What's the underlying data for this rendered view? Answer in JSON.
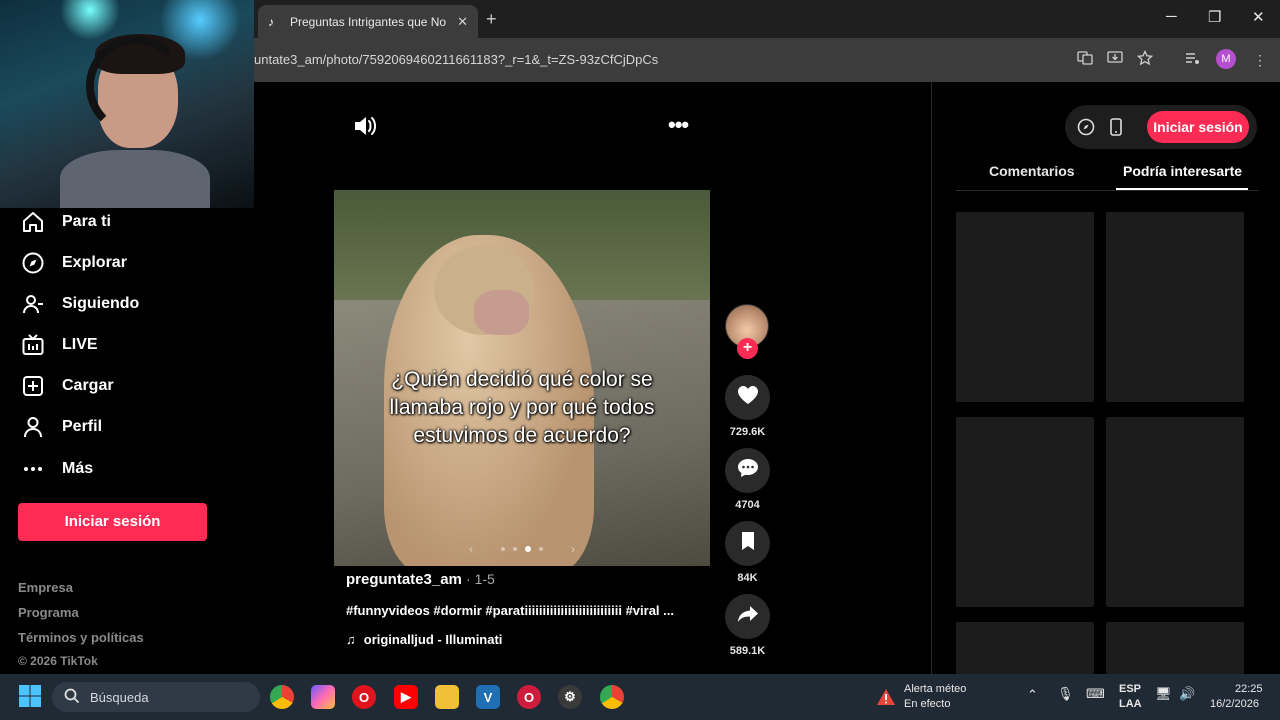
{
  "browser": {
    "tab_title": "Preguntas Intrigantes que No T",
    "tab_close": "✕",
    "new_tab": "+",
    "url": "untate3_am/photo/7592069460211661183?_r=1&_t=ZS-93zCfCjDpCs",
    "profile_initial": "M",
    "window_controls": {
      "minimize": "─",
      "maximize": "❐",
      "close": "✕"
    }
  },
  "sidebar": {
    "items": [
      {
        "label": "Para ti",
        "icon": "home-icon"
      },
      {
        "label": "Explorar",
        "icon": "compass-icon"
      },
      {
        "label": "Siguiendo",
        "icon": "following-icon"
      },
      {
        "label": "LIVE",
        "icon": "live-tv-icon"
      },
      {
        "label": "Cargar",
        "icon": "upload-icon"
      },
      {
        "label": "Perfil",
        "icon": "profile-icon"
      },
      {
        "label": "Más",
        "icon": "more-dots-icon"
      }
    ],
    "login_label": "Iniciar sesión",
    "footer": {
      "company": "Empresa",
      "program": "Programa",
      "terms": "Términos y políticas",
      "copyright": "© 2026 TikTok"
    }
  },
  "post": {
    "caption_line1": "¿Quién decidió qué color se",
    "caption_line2": "llamaba rojo y por qué todos",
    "caption_line3": "estuvimos de acuerdo?",
    "author": "preguntate3_am",
    "date": "· 1-5",
    "hashtags": "#funnyvideos #dormir #paratiiiiiiiiiiiiiiiiiiiiiiiiiii #viral ...",
    "music": "originalljud - Illuminati",
    "slide_prev": "‹",
    "slide_next": "›"
  },
  "actions": {
    "likes": "729.6K",
    "comments": "4704",
    "saves": "84K",
    "shares": "589.1K"
  },
  "right_panel": {
    "login_label": "Iniciar sesión",
    "tab_comments": "Comentarios",
    "tab_suggested": "Podría interesarte"
  },
  "taskbar": {
    "search_placeholder": "Búsqueda",
    "weather_title": "Alerta méteo",
    "weather_status": "En efecto",
    "lang1": "ESP",
    "lang2": "LAA",
    "time": "22:25",
    "date": "16/2/2026"
  },
  "colors": {
    "accent": "#fe2c55",
    "background": "#000000",
    "taskbar": "#202a35"
  }
}
